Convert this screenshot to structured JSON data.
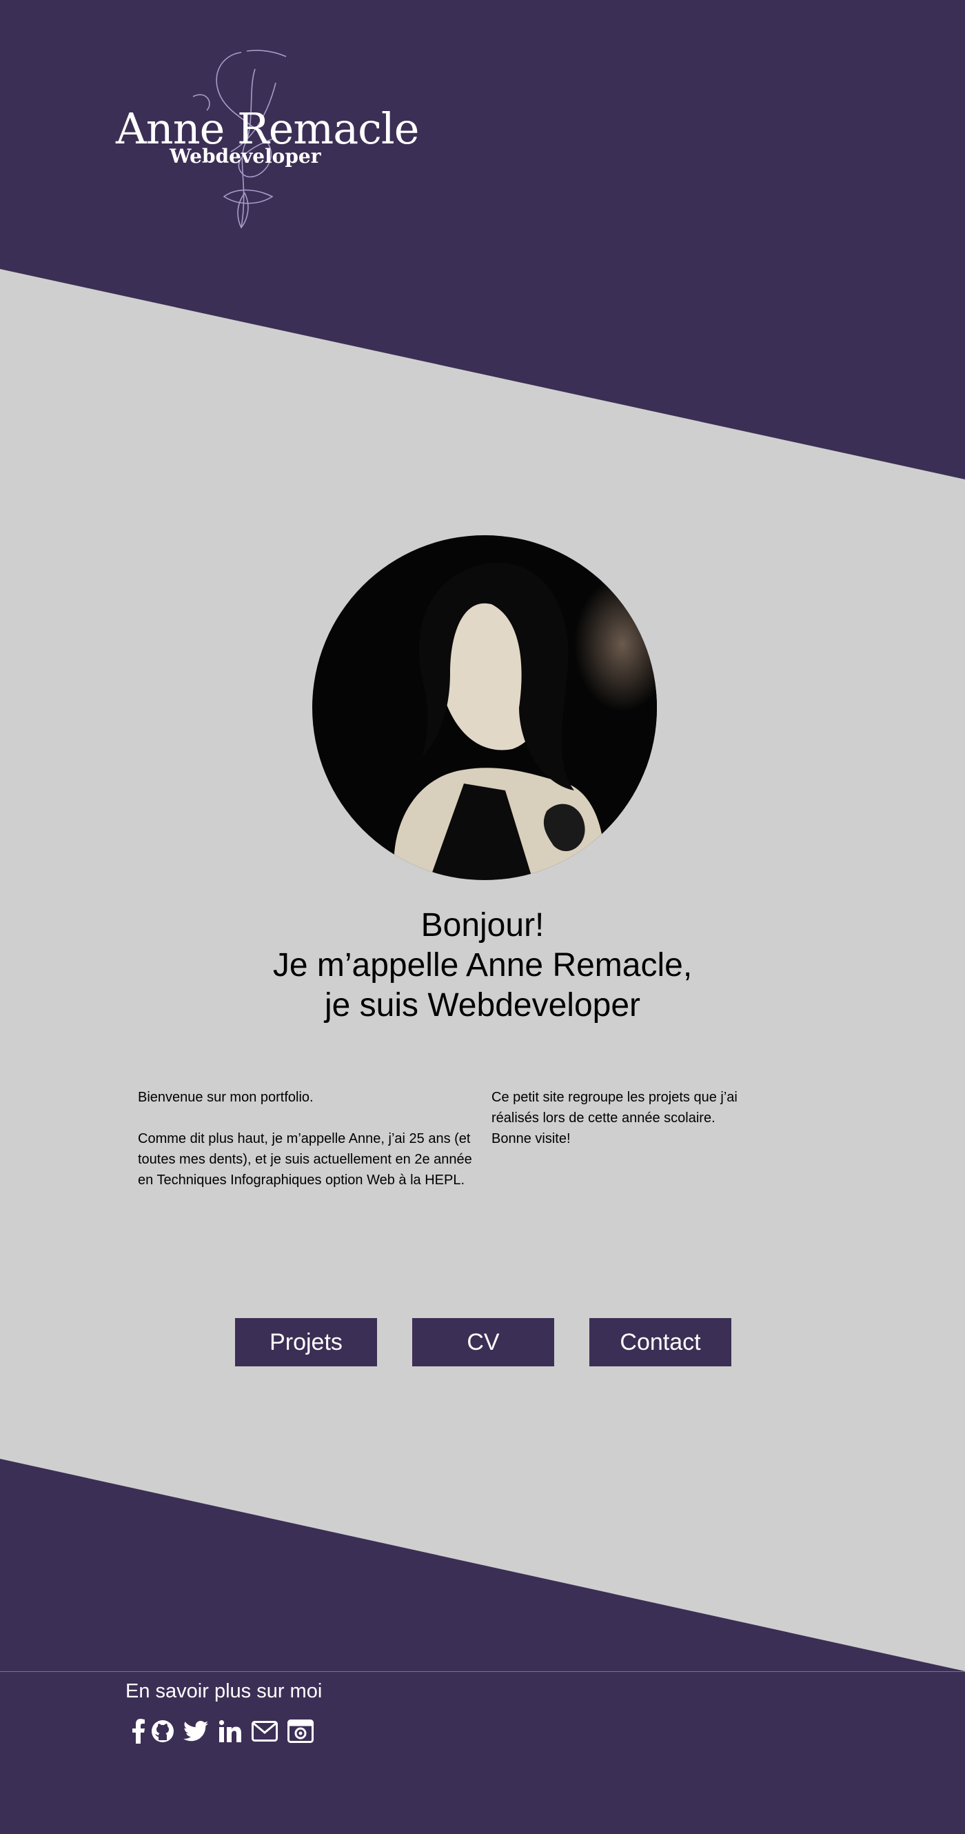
{
  "brand": {
    "name": "Anne Remacle",
    "tagline": "Webdeveloper"
  },
  "colors": {
    "primary": "#3c2f55",
    "background": "#cfcfcf",
    "text": "#000000",
    "light_text": "#ffffff"
  },
  "hero": {
    "portrait": "photo-of-anne-remacle",
    "greeting_line1": "Bonjour!",
    "greeting_line2": "Je m’appelle Anne Remacle,",
    "greeting_line3": "je suis Webdeveloper"
  },
  "about": {
    "left_p1": "Bienvenue sur mon portfolio.",
    "left_p2": "Comme dit plus haut, je m’appelle Anne, j’ai 25 ans (et toutes mes dents), et je suis actuellement en 2e année en Techniques Infographiques option Web à la HEPL.",
    "right_p1": "Ce petit site regroupe les projets que j’ai réalisés lors de cette année scolaire.",
    "right_p2": "Bonne visite!"
  },
  "nav": {
    "projets": "Projets",
    "cv": "CV",
    "contact": "Contact"
  },
  "footer": {
    "title": "En savoir plus sur moi",
    "socials": [
      "facebook-icon",
      "github-icon",
      "twitter-icon",
      "linkedin-icon",
      "mail-icon",
      "camera-icon"
    ]
  }
}
